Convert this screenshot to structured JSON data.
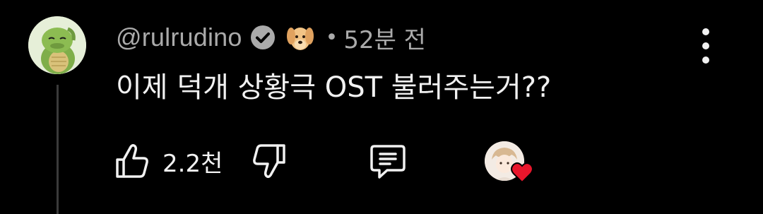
{
  "comment": {
    "username": "@rulrudino",
    "separator": "•",
    "time": "52분 전",
    "text": "이제 덕개 상황극 OST 불러주는거??",
    "like_count": "2.2천"
  },
  "icons": {
    "avatar": "dinosaur-avatar-icon",
    "verified": "verified-check-icon",
    "badge": "dog-emoji-icon",
    "more": "more-vertical-icon",
    "like": "thumbs-up-icon",
    "dislike": "thumbs-down-icon",
    "reply": "reply-comment-icon",
    "creator_heart": "creator-heart-icon"
  },
  "colors": {
    "background": "#000000",
    "primary_text": "#f1f1f1",
    "secondary_text": "#aaaaaa",
    "heart": "#e8162b"
  }
}
